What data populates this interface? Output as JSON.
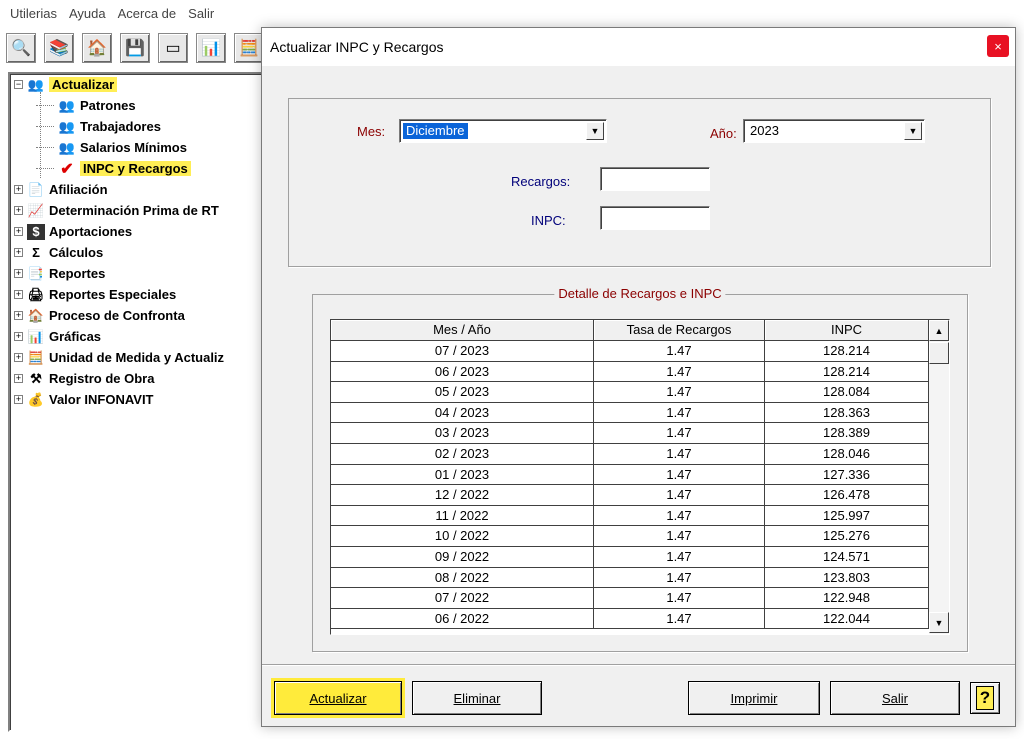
{
  "menubar": {
    "items": [
      "Utilerias",
      "Ayuda",
      "Acerca de",
      "Salir"
    ]
  },
  "toolbar": {
    "icons": [
      "search-icon",
      "books-icon",
      "house-icon",
      "save-icon",
      "eraser-icon",
      "reports-icon",
      "calculator-icon"
    ]
  },
  "tree": {
    "root": {
      "label": "Actualizar",
      "expander": "−"
    },
    "children": [
      "Patrones",
      "Trabajadores",
      "Salarios Mínimos",
      "INPC y Recargos"
    ],
    "items": [
      {
        "label": "Afiliación",
        "expander": "+"
      },
      {
        "label": "Determinación Prima de RT",
        "expander": "+"
      },
      {
        "label": "Aportaciones",
        "expander": "+"
      },
      {
        "label": "Cálculos",
        "expander": "+"
      },
      {
        "label": "Reportes",
        "expander": "+"
      },
      {
        "label": "Reportes Especiales",
        "expander": "+"
      },
      {
        "label": "Proceso de Confronta",
        "expander": "+"
      },
      {
        "label": "Gráficas",
        "expander": "+"
      },
      {
        "label": "Unidad de Medida y Actualiz",
        "expander": "+"
      },
      {
        "label": "Registro de Obra",
        "expander": "+"
      },
      {
        "label": "Valor INFONAVIT",
        "expander": "+"
      }
    ]
  },
  "dialog": {
    "title": "Actualizar INPC y Recargos",
    "close": "×",
    "mes_label": "Mes:",
    "mes_value": "Diciembre",
    "anio_label": "Año:",
    "anio_value": "2023",
    "recargos_label": "Recargos:",
    "recargos_value": "",
    "inpc_label": "INPC:",
    "inpc_value": "",
    "group_title": "Detalle de Recargos e INPC",
    "columns": [
      "Mes / Año",
      "Tasa de Recargos",
      "INPC"
    ],
    "rows": [
      [
        "07 / 2023",
        "1.47",
        "128.214"
      ],
      [
        "06 / 2023",
        "1.47",
        "128.214"
      ],
      [
        "05 / 2023",
        "1.47",
        "128.084"
      ],
      [
        "04 / 2023",
        "1.47",
        "128.363"
      ],
      [
        "03 / 2023",
        "1.47",
        "128.389"
      ],
      [
        "02 / 2023",
        "1.47",
        "128.046"
      ],
      [
        "01 / 2023",
        "1.47",
        "127.336"
      ],
      [
        "12 / 2022",
        "1.47",
        "126.478"
      ],
      [
        "11 / 2022",
        "1.47",
        "125.997"
      ],
      [
        "10 / 2022",
        "1.47",
        "125.276"
      ],
      [
        "09 / 2022",
        "1.47",
        "124.571"
      ],
      [
        "08 / 2022",
        "1.47",
        "123.803"
      ],
      [
        "07 / 2022",
        "1.47",
        "122.948"
      ],
      [
        "06 / 2022",
        "1.47",
        "122.044"
      ]
    ],
    "buttons": {
      "actualizar": "Actualizar",
      "eliminar": "Eliminar",
      "imprimir": "Imprimir",
      "salir": "Salir",
      "help": "?"
    },
    "scroll_arrows": {
      "up": "▲",
      "down": "▼"
    },
    "combo_arrow": "▼"
  },
  "colors": {
    "highlight": "#ffee55",
    "selection": "#0a64d8",
    "label_red": "#8b0000",
    "label_blue": "#00007a",
    "close": "#e81123"
  }
}
